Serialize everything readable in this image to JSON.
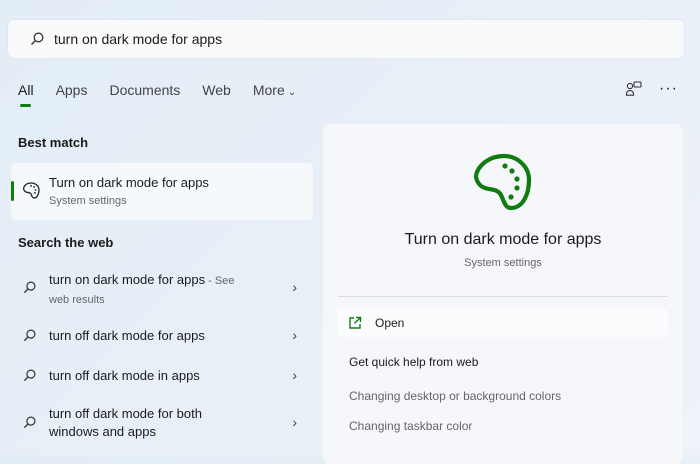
{
  "search": {
    "value": "turn on dark mode for apps"
  },
  "tabs": [
    {
      "label": "All"
    },
    {
      "label": "Apps"
    },
    {
      "label": "Documents"
    },
    {
      "label": "Web"
    },
    {
      "label": "More"
    }
  ],
  "best_match": {
    "heading": "Best match",
    "title": "Turn on dark mode for apps",
    "subtitle": "System settings"
  },
  "web": {
    "heading": "Search the web",
    "items": [
      {
        "label": "turn on dark mode for apps",
        "suffix": " - See",
        "line2": "web results"
      },
      {
        "label": "turn off dark mode for apps"
      },
      {
        "label": "turn off dark mode in apps"
      },
      {
        "label": "turn off dark mode for both",
        "line2": "windows and apps"
      }
    ]
  },
  "panel": {
    "title": "Turn on dark mode for apps",
    "subtitle": "System settings",
    "open_label": "Open",
    "help_heading": "Get quick help from web",
    "links": [
      "Changing desktop or background colors",
      "Changing taskbar color"
    ]
  },
  "colors": {
    "accent": "#107c10"
  }
}
